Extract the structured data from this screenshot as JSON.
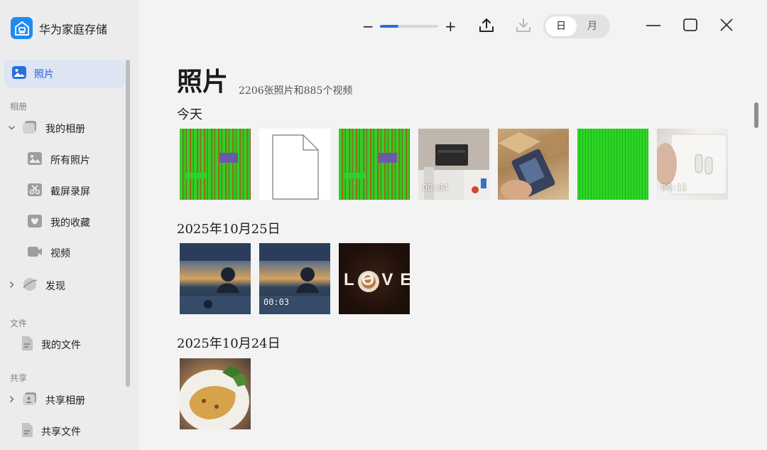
{
  "app": {
    "title": "华为家庭存储"
  },
  "sidebar": {
    "active": {
      "label": "照片",
      "icon": "photo-icon"
    },
    "sections": {
      "albums": "相册",
      "files": "文件",
      "share": "共享"
    },
    "my_albums": {
      "label": "我的相册",
      "icon": "album-stack-icon"
    },
    "album_items": [
      {
        "label": "所有照片",
        "icon": "all-photos-icon"
      },
      {
        "label": "截屏录屏",
        "icon": "screenshot-icon"
      },
      {
        "label": "我的收藏",
        "icon": "favorite-heart-icon"
      },
      {
        "label": "视频",
        "icon": "video-icon"
      }
    ],
    "discover": {
      "label": "发现",
      "icon": "discover-planet-icon"
    },
    "my_files": {
      "label": "我的文件",
      "icon": "file-icon"
    },
    "shared_albums": {
      "label": "共享相册",
      "icon": "shared-album-icon"
    },
    "shared_files": {
      "label": "共享文件",
      "icon": "shared-file-icon"
    }
  },
  "toolbar": {
    "zoom_out": "−",
    "zoom_in": "+",
    "zoom_level": 0.32,
    "view_day": "日",
    "view_month": "月",
    "selected_view": "日",
    "accent": "#2a6fdb"
  },
  "main": {
    "title": "照片",
    "subtitle": "2206张照片和885个视频",
    "groups": [
      {
        "date": "今天",
        "items": [
          {
            "kind": "glitch",
            "duration": ""
          },
          {
            "kind": "document",
            "duration": ""
          },
          {
            "kind": "glitch",
            "duration": ""
          },
          {
            "kind": "printer",
            "duration": "00:04"
          },
          {
            "kind": "boxes",
            "duration": ""
          },
          {
            "kind": "green",
            "duration": ""
          },
          {
            "kind": "airpods",
            "duration": "00:11"
          }
        ]
      },
      {
        "date": "2025年10月25日",
        "items": [
          {
            "kind": "sunset",
            "duration": ""
          },
          {
            "kind": "sunset",
            "duration": "00:03"
          },
          {
            "kind": "love",
            "duration": "",
            "text": "LOVE"
          }
        ]
      },
      {
        "date": "2025年10月24日",
        "items": [
          {
            "kind": "food",
            "duration": ""
          }
        ]
      }
    ]
  }
}
